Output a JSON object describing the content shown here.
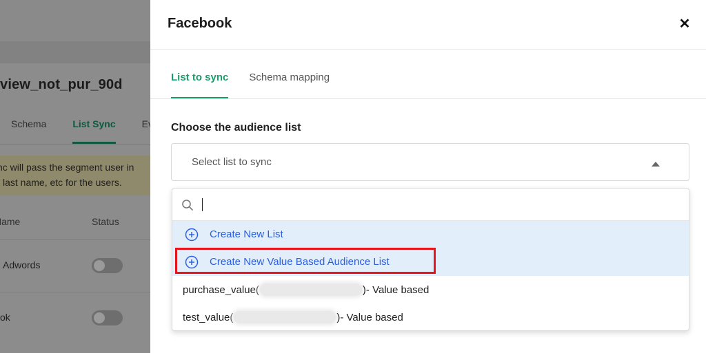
{
  "background": {
    "title": "view_not_pur_90d",
    "tabs": [
      "Schema",
      "List Sync",
      "Eve"
    ],
    "notice_line1": "nc will pass the segment user in",
    "notice_line2": "last name, etc for the users.",
    "table_header_name": "Name",
    "table_header_status": "Status",
    "rows": [
      "Adwords",
      "ok"
    ]
  },
  "drawer": {
    "title": "Facebook",
    "close_icon": "close-icon",
    "tabs": [
      {
        "label": "List to sync",
        "active": true
      },
      {
        "label": "Schema mapping",
        "active": false
      }
    ],
    "section_label": "Choose the audience list",
    "select": {
      "placeholder": "Select list to sync",
      "expanded": true
    },
    "dropdown": {
      "search_value": "",
      "options": [
        {
          "label": "Create New List",
          "icon": "plus-circle-icon",
          "type": "create"
        },
        {
          "label": "Create New Value Based Audience List",
          "icon": "plus-circle-icon",
          "type": "create",
          "highlighted": true
        },
        {
          "prefix": "purchase_value(",
          "suffix": ")- Value based",
          "type": "list"
        },
        {
          "prefix": "test_value(",
          "suffix": ")- Value based",
          "type": "list"
        }
      ]
    }
  },
  "colors": {
    "accent_green": "#1a9c6a",
    "link_blue": "#2c5fe0",
    "option_highlight_bg": "#e3eefb",
    "annotation_red": "#e8141c"
  }
}
